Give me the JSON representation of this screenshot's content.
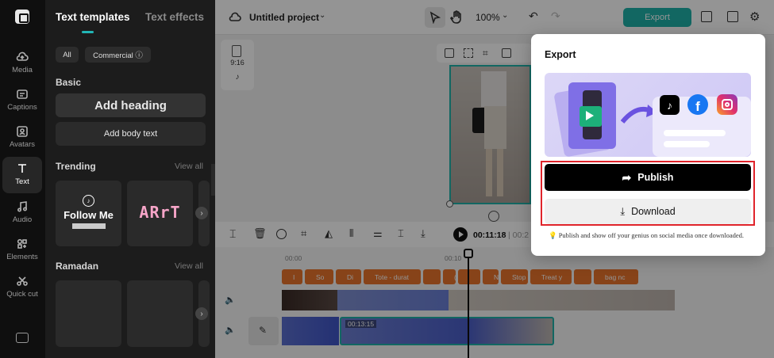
{
  "rail": {
    "items": [
      {
        "label": "Media",
        "icon": "cloud-upload-icon"
      },
      {
        "label": "Captions",
        "icon": "captions-icon"
      },
      {
        "label": "Avatars",
        "icon": "avatar-icon"
      },
      {
        "label": "Text",
        "icon": "text-icon"
      },
      {
        "label": "Audio",
        "icon": "music-icon"
      },
      {
        "label": "Elements",
        "icon": "elements-icon"
      },
      {
        "label": "Quick cut",
        "icon": "scissors-icon"
      }
    ],
    "keyboard_icon": "keyboard-icon"
  },
  "panel": {
    "tab_templates": "Text templates",
    "tab_effects": "Text effects",
    "chip_all": "All",
    "chip_commercial": "Commercial ⓘ",
    "basic_label": "Basic",
    "add_heading": "Add heading",
    "add_body": "Add body text",
    "trending_label": "Trending",
    "view_all": "View all",
    "tile1_text": "Follow Me",
    "tile2_text": "ARrT",
    "ramadan_label": "Ramadan",
    "view_all2": "View all"
  },
  "topbar": {
    "project_name": "Untitled project",
    "zoom": "100%",
    "export_label": "Export"
  },
  "canvas": {
    "ratio": "9:16"
  },
  "timeline": {
    "time_current": "00:11:18",
    "time_sep": "| 00:2",
    "ruler": [
      "00:00",
      "00:10"
    ],
    "clip_time": "00:13:15",
    "captions": [
      "I",
      "So",
      "Di",
      "Tote - durat",
      "",
      "(",
      "",
      "N",
      "Stop",
      "Treat y",
      "",
      "bag nc"
    ]
  },
  "export_modal": {
    "title": "Export",
    "publish": "Publish",
    "download": "Download",
    "hint": "💡 Publish and show off your genius on social media once downloaded."
  },
  "colors": {
    "accent": "#20b2aa",
    "highlight": "#e0242b",
    "caption_chip": "#e8742c"
  }
}
